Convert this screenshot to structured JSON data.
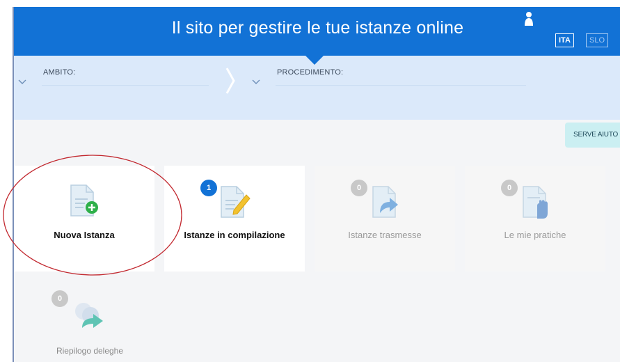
{
  "header": {
    "title": "Il sito per gestire le tue istanze online",
    "languages": [
      {
        "label": "ITA",
        "active": true
      },
      {
        "label": "SLO",
        "active": false
      }
    ],
    "brand_color": "#1272d6"
  },
  "filters": {
    "ambito_label": "AMBITO:",
    "procedimento_label": "PROCEDIMENTO:"
  },
  "help": {
    "label": "SERVE AIUTO"
  },
  "cards": [
    {
      "label": "Nuova Istanza",
      "icon": "new-document-add-icon",
      "badge": null
    },
    {
      "label": "Istanze in compilazione",
      "icon": "document-edit-icon",
      "badge": "1"
    },
    {
      "label": "Istanze trasmesse",
      "icon": "document-send-icon",
      "badge": "0"
    },
    {
      "label": "Le mie pratiche",
      "icon": "document-hand-icon",
      "badge": "0"
    },
    {
      "label": "Riepilogo deleghe",
      "icon": "delegation-share-icon",
      "badge": "0"
    }
  ]
}
